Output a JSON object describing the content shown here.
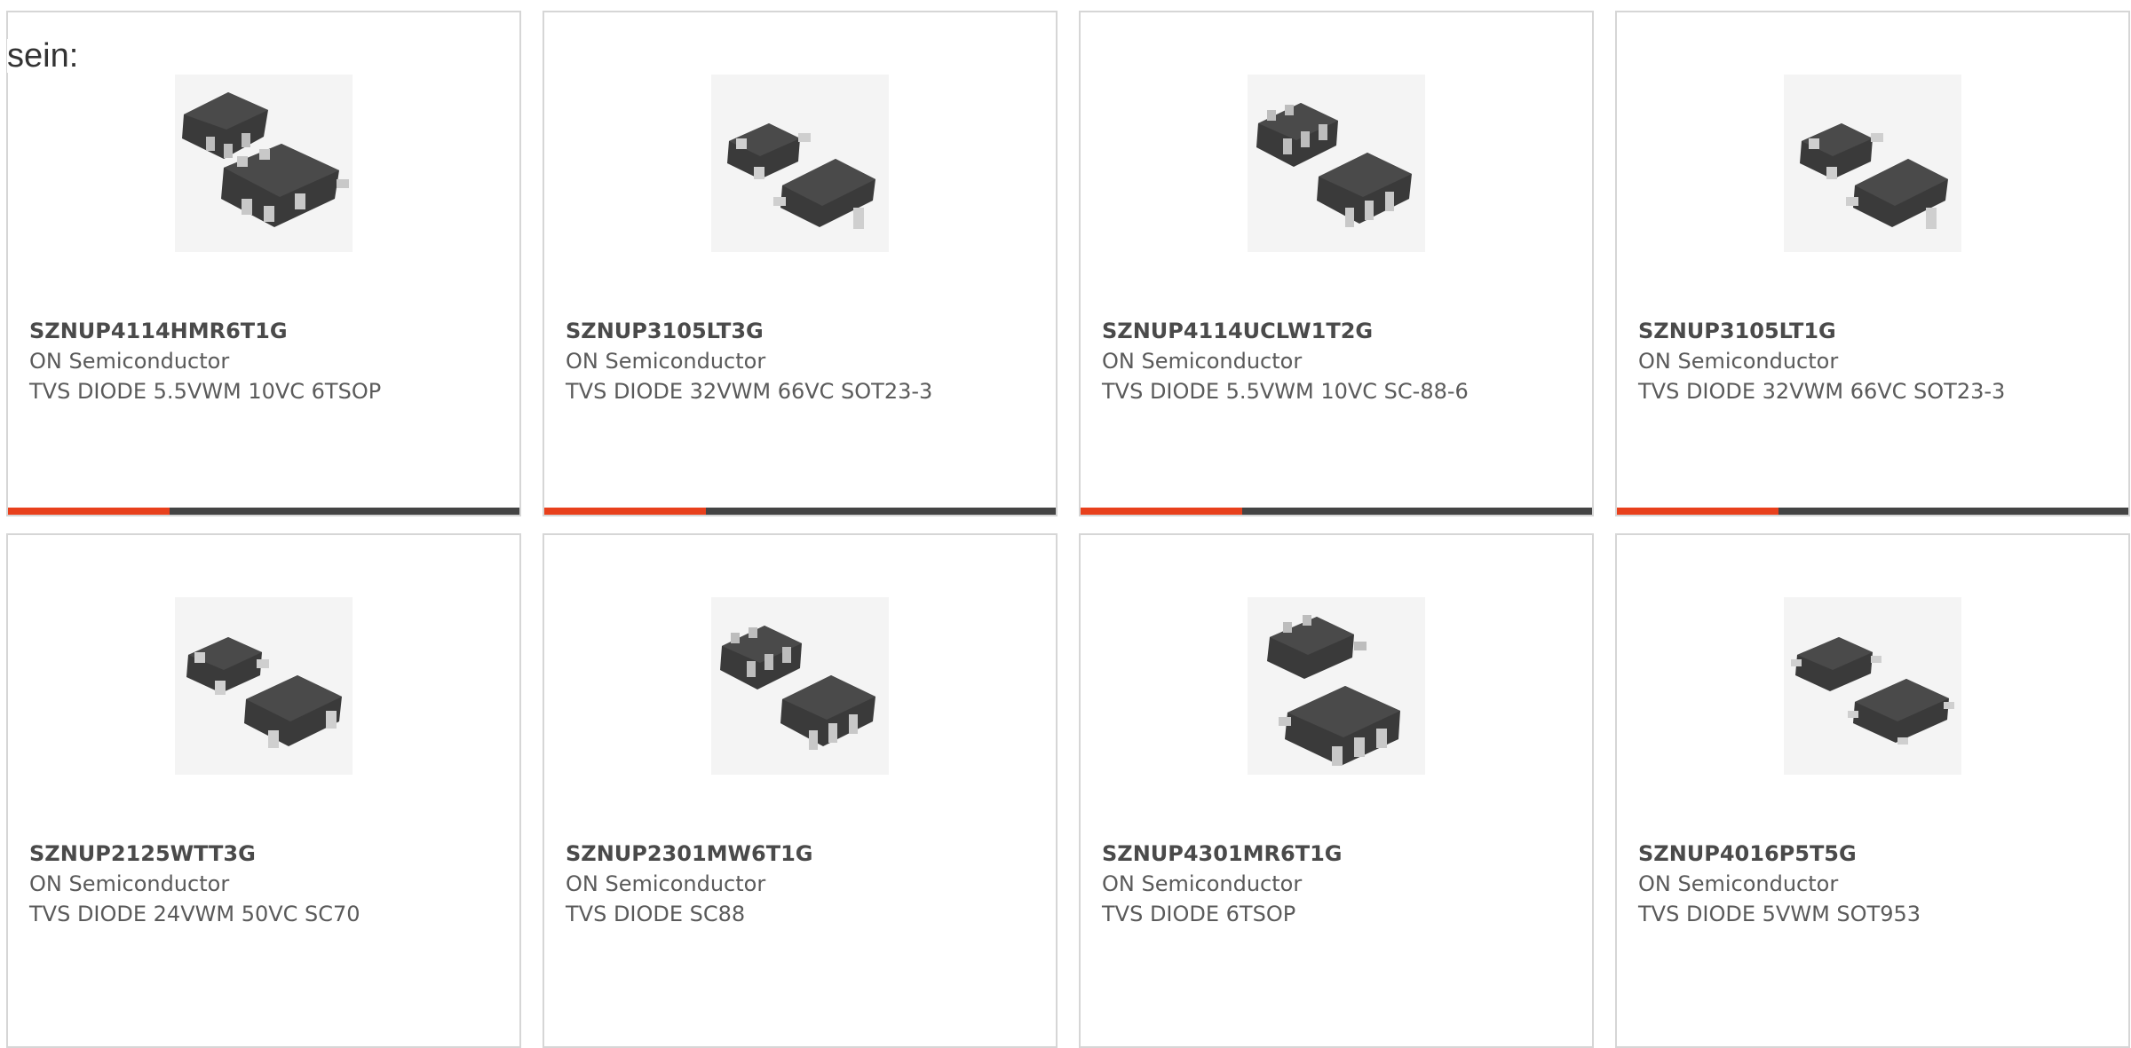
{
  "intro_text": "sein:",
  "colors": {
    "accent": "#e8401c",
    "bar": "#444444",
    "border": "#d6d6d6",
    "text": "#5a5a5a"
  },
  "products": [
    {
      "part_number": "SZNUP4114HMR6T1G",
      "manufacturer": "ON Semiconductor",
      "description": "TVS DIODE 5.5VWM 10VC 6TSOP",
      "image_icon": "sot-6pin-package-icon"
    },
    {
      "part_number": "SZNUP3105LT3G",
      "manufacturer": "ON Semiconductor",
      "description": "TVS DIODE 32VWM 66VC SOT23-3",
      "image_icon": "sot23-3pin-package-icon"
    },
    {
      "part_number": "SZNUP4114UCLW1T2G",
      "manufacturer": "ON Semiconductor",
      "description": "TVS DIODE 5.5VWM 10VC SC-88-6",
      "image_icon": "sc88-6pin-package-icon"
    },
    {
      "part_number": "SZNUP3105LT1G",
      "manufacturer": "ON Semiconductor",
      "description": "TVS DIODE 32VWM 66VC SOT23-3",
      "image_icon": "sot23-3pin-package-icon"
    },
    {
      "part_number": "SZNUP2125WTT3G",
      "manufacturer": "ON Semiconductor",
      "description": "TVS DIODE 24VWM 50VC SC70",
      "image_icon": "sc70-package-icon"
    },
    {
      "part_number": "SZNUP2301MW6T1G",
      "manufacturer": "ON Semiconductor",
      "description": "TVS DIODE SC88",
      "image_icon": "sc88-6pin-package-icon"
    },
    {
      "part_number": "SZNUP4301MR6T1G",
      "manufacturer": "ON Semiconductor",
      "description": "TVS DIODE 6TSOP",
      "image_icon": "tsop-6pin-package-icon"
    },
    {
      "part_number": "SZNUP4016P5T5G",
      "manufacturer": "ON Semiconductor",
      "description": "TVS DIODE 5VWM SOT953",
      "image_icon": "sot953-package-icon"
    }
  ]
}
